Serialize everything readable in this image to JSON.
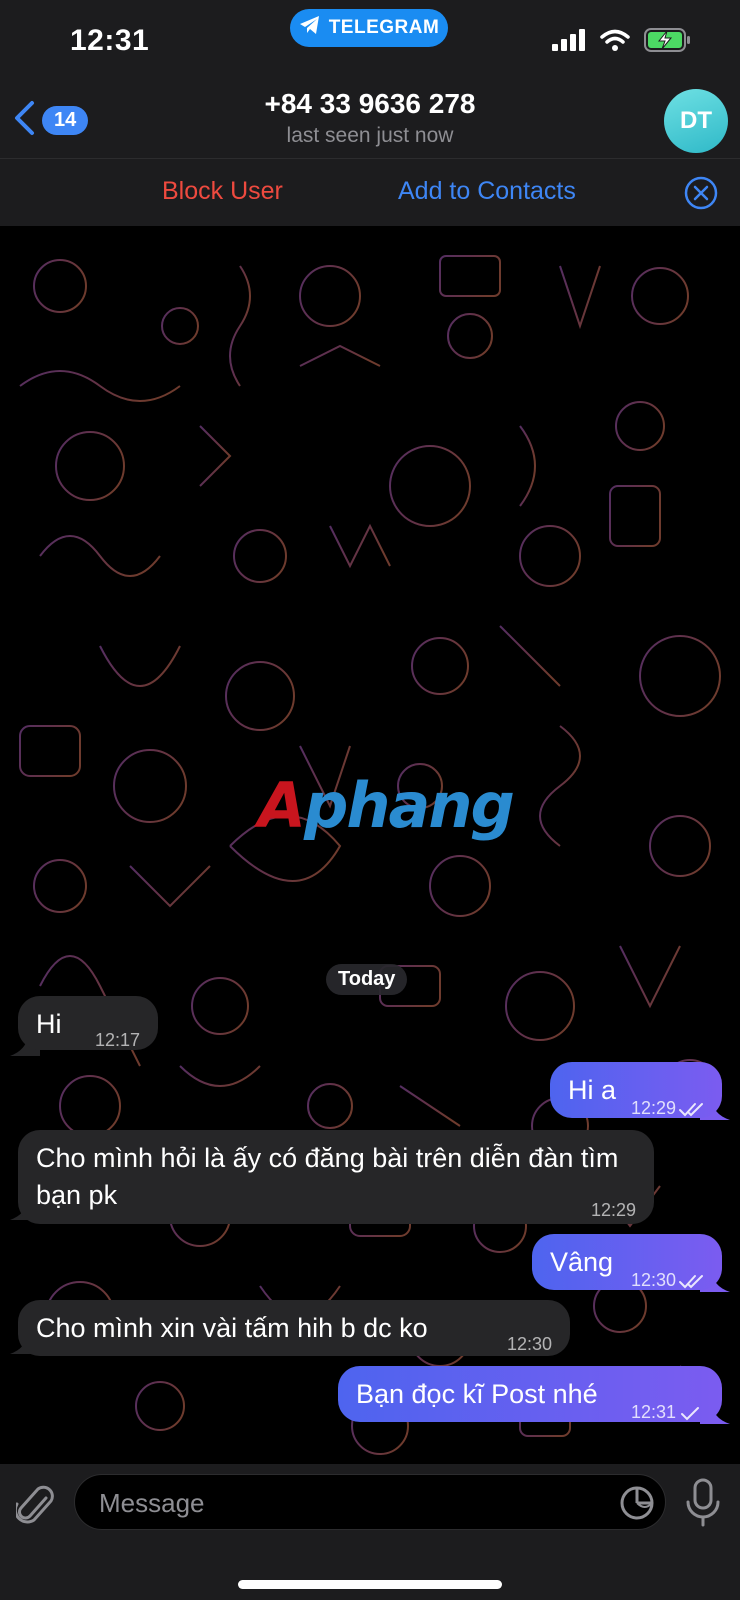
{
  "status_bar": {
    "time": "12:31",
    "app_pill": "TELEGRAM"
  },
  "header": {
    "back_count": "14",
    "title": "+84 33 9636 278",
    "subtitle": "last seen just now",
    "avatar_initials": "DT"
  },
  "action_bar": {
    "block_label": "Block User",
    "add_label": "Add to Contacts"
  },
  "chat": {
    "watermark_red": "A",
    "watermark_blue": "phang",
    "date_label": "Today",
    "messages": [
      {
        "text": "Hi",
        "time": "12:17"
      },
      {
        "text": "Hi a",
        "time": "12:29"
      },
      {
        "text": "Cho mình hỏi là ấy có đăng bài trên diễn đàn tìm bạn pk",
        "time": "12:29"
      },
      {
        "text": "Vâng",
        "time": "12:30"
      },
      {
        "text": "Cho mình xin vài tấm hih b dc ko",
        "time": "12:30"
      },
      {
        "text": "Bạn đọc kĩ Post nhé",
        "time": "12:31"
      }
    ]
  },
  "input_bar": {
    "placeholder": "Message"
  },
  "colors": {
    "accent": "#3e86f5",
    "danger": "#ee4a3f",
    "outgoing_start": "#4e64ef",
    "outgoing_end": "#7b5cf0",
    "incoming": "#262628"
  }
}
